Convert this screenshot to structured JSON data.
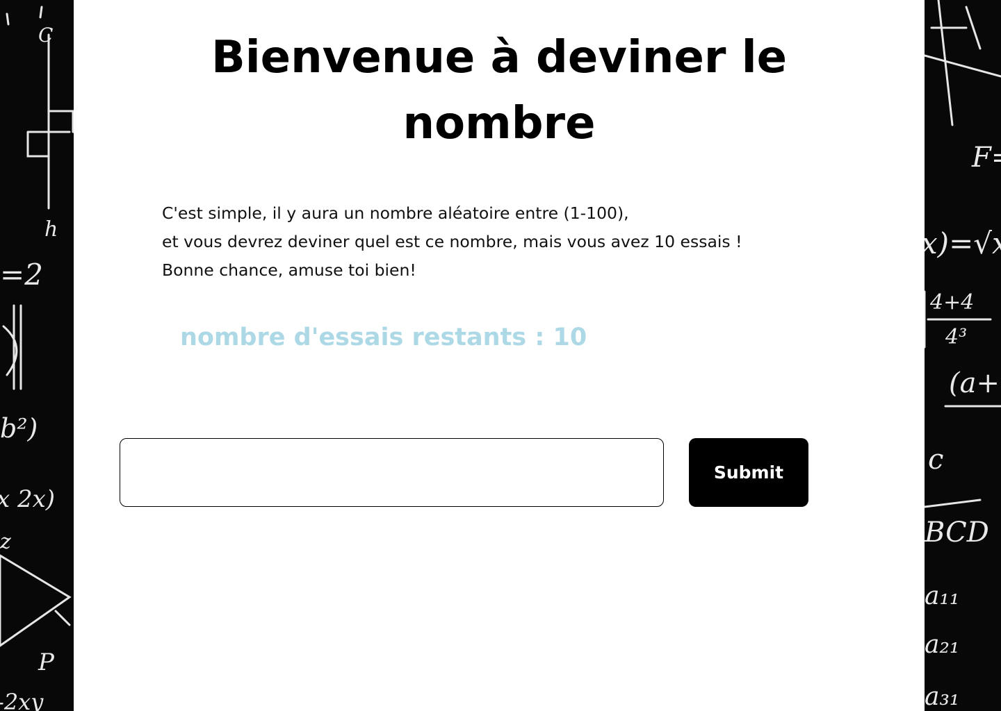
{
  "header": {
    "title_line1": "Bienvenue à deviner le",
    "title_line2": "nombre"
  },
  "intro": {
    "line1": "C'est simple, il y aura un nombre aléatoire entre (1-100),",
    "line2": "et vous devrez deviner quel est ce nombre, mais vous avez 10 essais !",
    "line3": "Bonne chance, amuse toi bien!"
  },
  "status": {
    "attempts_text": "nombre d'essais restants : 10",
    "attempts_color": "#add8e6"
  },
  "form": {
    "guess_value": "",
    "submit_label": "Submit"
  },
  "background": {
    "left_formulas": [
      "C",
      "h",
      "=2",
      "b²)",
      "x 2x)",
      "z",
      "P",
      "-2xy"
    ],
    "right_formulas": [
      "F=",
      "x)=√x",
      "4+4",
      "4³",
      "(a+",
      "c",
      "BCD",
      "a₁₁",
      "a₂₁",
      "a₃₁"
    ]
  },
  "colors": {
    "panel": "#ffffff",
    "chalkboard": "#080808",
    "button": "#000000"
  }
}
